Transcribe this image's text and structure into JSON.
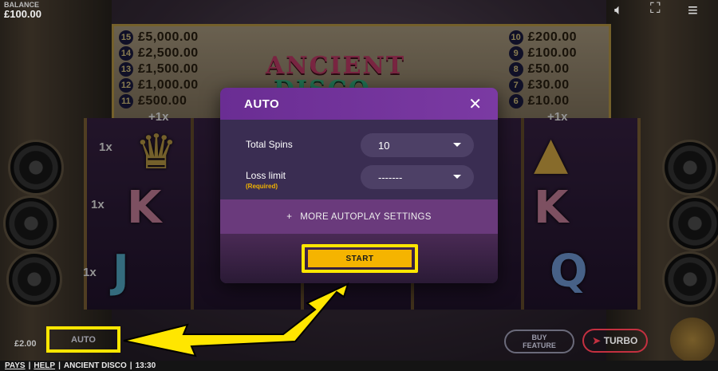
{
  "hud": {
    "balance_label": "BALANCE",
    "balance_value": "£100.00",
    "bet_value": "£2.00",
    "auto_label": "AUTO",
    "buy_feature_line1": "BUY",
    "buy_feature_line2": "FEATURE",
    "turbo_label": "TURBO"
  },
  "paytable": {
    "left": [
      {
        "n": "15",
        "prize": "£5,000.00"
      },
      {
        "n": "14",
        "prize": "£2,500.00"
      },
      {
        "n": "13",
        "prize": "£1,500.00"
      },
      {
        "n": "12",
        "prize": "£1,000.00"
      },
      {
        "n": "11",
        "prize": "£500.00"
      }
    ],
    "right": [
      {
        "n": "10",
        "prize": "£200.00"
      },
      {
        "n": "9",
        "prize": "£100.00"
      },
      {
        "n": "8",
        "prize": "£50.00"
      },
      {
        "n": "7",
        "prize": "£30.00"
      },
      {
        "n": "6",
        "prize": "£10.00"
      }
    ]
  },
  "game": {
    "logo_line1": "ANCIENT",
    "logo_line2": "DISCO",
    "multiplier": "+1x",
    "side_multiplier": "1x"
  },
  "modal": {
    "title": "AUTO",
    "close_glyph": "✕",
    "total_spins_label": "Total Spins",
    "total_spins_value": "10",
    "loss_limit_label": "Loss limit",
    "loss_limit_required": "(Required)",
    "loss_limit_value": "-------",
    "more_settings_plus": "+",
    "more_settings_label": "MORE AUTOPLAY SETTINGS",
    "start_label": "START"
  },
  "footer": {
    "pays": "PAYS",
    "sep1": "|",
    "help": "HELP",
    "sep2": "|",
    "game_name": "ANCIENT DISCO",
    "sep3": "|",
    "clock": "13:30"
  },
  "colors": {
    "highlight": "#ffe600",
    "start_button": "#f5b400",
    "modal_header": "#6a2d93"
  }
}
